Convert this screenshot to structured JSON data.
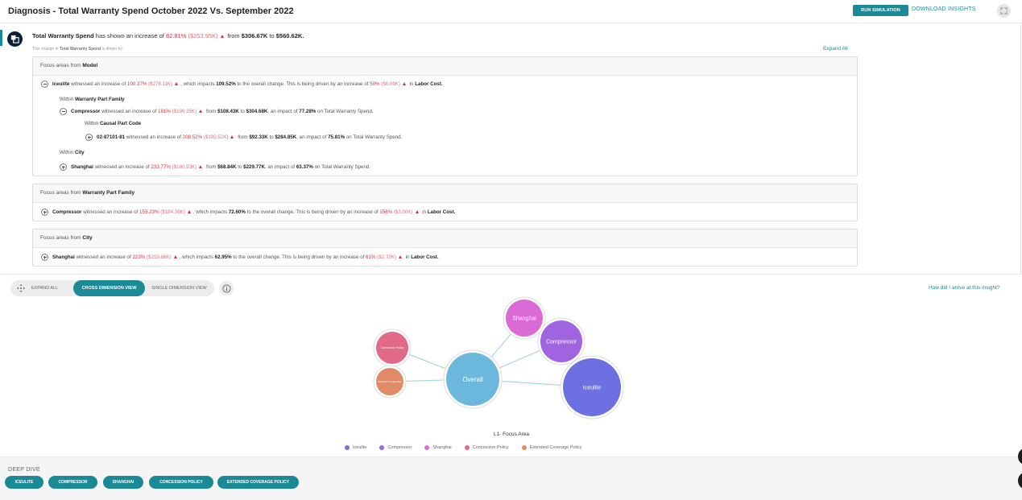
{
  "header": {
    "title": "Diagnosis - Total Warranty Spend October 2022 Vs. September 2022",
    "run_simulation": "RUN SIMULATION",
    "download_insights": "DOWNLOAD INSIGHTS",
    "fullscreen_icon": "expand-icon"
  },
  "summary": {
    "metric": "Total Warranty Spend",
    "text1": "has shown an increase of",
    "pct": "82.81%",
    "abs": "($253.95K)",
    "from_word": "from",
    "from_val": "$306.67K",
    "to_word": "to",
    "to_val": "$560.62K.",
    "note_pre": "This change in",
    "note_metric": "Total Warranty Spend",
    "note_post": "is driven by:",
    "expand_all": "Expand All"
  },
  "cards": {
    "model": {
      "head_pre": "Focus areas from",
      "head_dim": "Model",
      "r1": {
        "name": "Iceulite",
        "t1": "witnessed an increase of",
        "pct": "100.27%",
        "abs": "($278.11K)",
        "t2": ", which impacts",
        "impact": "109.52%",
        "t3": "to the overall change. This is being driven by an increase of",
        "dpct": "59%",
        "dabs": "($6.09K)",
        "t4": "in",
        "driver": "Labor Cost."
      },
      "l1": {
        "pre": "Within",
        "dim": "Warranty Part Family"
      },
      "r2": {
        "name": "Compressor",
        "t1": "witnessed an increase of",
        "pct": "181%",
        "abs": "($196.25K)",
        "from_word": "from",
        "from_val": "$108.43K",
        "to_word": "to",
        "to_val": "$304.68K",
        "t2": ", an impact of",
        "impact": "77.28%",
        "t3": "on Total Warranty Spend."
      },
      "l2": {
        "pre": "Within",
        "dim": "Causal Part Code"
      },
      "r3": {
        "name": "02-87101-81",
        "t1": "witnessed an increase of",
        "pct": "208.52%",
        "abs": "($192.52K)",
        "from_word": "from",
        "from_val": "$92.33K",
        "to_word": "to",
        "to_val": "$284.85K",
        "t2": ", an impact of",
        "impact": "75.81%",
        "t3": "on Total Warranty Spend."
      },
      "l3": {
        "pre": "Within",
        "dim": "City"
      },
      "r4": {
        "name": "Shanghai",
        "t1": "witnessed an increase of",
        "pct": "233.77%",
        "abs": "($160.93K)",
        "from_word": "from",
        "from_val": "$68.84K",
        "to_word": "to",
        "to_val": "$229.77K",
        "t2": ", an impact of",
        "impact": "63.37%",
        "t3": "on Total Warranty Spend."
      }
    },
    "wpf": {
      "head_pre": "Focus areas from",
      "head_dim": "Warranty Part Family",
      "r1": {
        "name": "Compressor",
        "t1": "witnessed an increase of",
        "pct": "153.23%",
        "abs": "($184.36K)",
        "t2": ", which impacts",
        "impact": "72.60%",
        "t3": "to the overall change. This is being driven by an increase of",
        "dpct": "156%",
        "dabs": "($3.50K)",
        "t4": "in",
        "driver": "Labor Cost."
      }
    },
    "city": {
      "head_pre": "Focus areas from",
      "head_dim": "City",
      "r1": {
        "name": "Shanghai",
        "t1": "witnessed an increase of",
        "pct": "223%",
        "abs": "($159.86K)",
        "t2": ", which impacts",
        "impact": "62.95%",
        "t3": "to the overall change. This is being driven by an increase of",
        "dpct": "61%",
        "dabs": "($2.72K)",
        "t4": "in",
        "driver": "Labor Cost."
      }
    }
  },
  "view": {
    "expand_all": "EXPAND ALL",
    "cross": "CROSS DIMENSION VIEW",
    "single": "SINGLE DIMENSION VIEW",
    "how": "How did I arrive at this insight?"
  },
  "chart_data": {
    "type": "bubble",
    "title": "L1- Focus Area",
    "center": {
      "name": "Overall",
      "color": "#6bb8dc"
    },
    "nodes": [
      {
        "name": "Iceulite",
        "color": "#6c70e0"
      },
      {
        "name": "Compressor",
        "color": "#a064e0"
      },
      {
        "name": "Shanghai",
        "color": "#dc6ad6"
      },
      {
        "name": "Concession Policy",
        "color": "#e06a88"
      },
      {
        "name": "Extended Coverage Policy",
        "color": "#e08a68"
      }
    ],
    "legend": [
      "Iceulite",
      "Compressor",
      "Shanghai",
      "Concession Policy",
      "Extended Coverage Policy"
    ],
    "colors": {
      "link": "#a9d4e6"
    }
  },
  "deep_dive": {
    "title": "DEEP DIVE",
    "chips": [
      "ICEULITE",
      "COMPRESSOR",
      "SHANGHAI",
      "CONCESSION POLICY",
      "EXTENDED COVERAGE POLICY"
    ]
  },
  "colors": {
    "accent": "#1a8a96",
    "increase": "#d9313c"
  }
}
